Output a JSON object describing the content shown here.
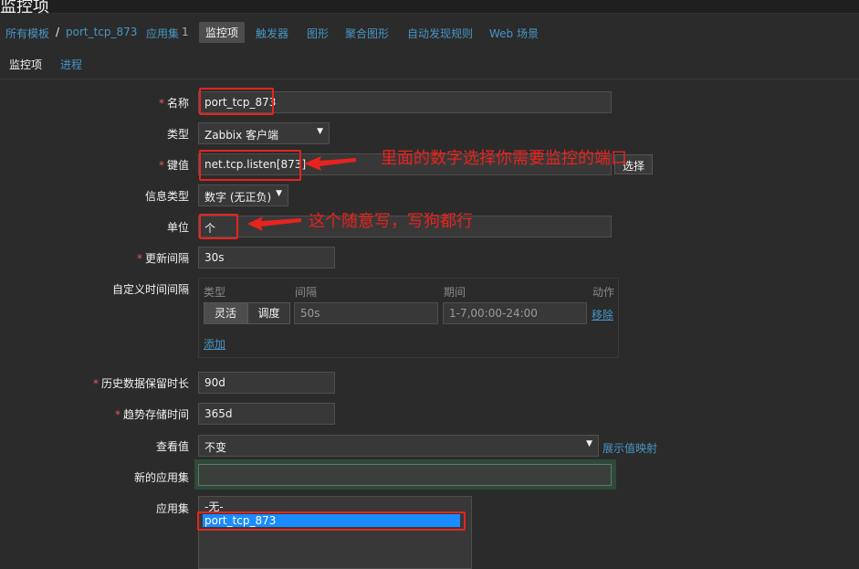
{
  "header": {
    "title": "监控项"
  },
  "breadcrumb": {
    "all_templates": "所有模板",
    "separator": "/",
    "template": "port_tcp_873",
    "applications": "应用集",
    "applications_count": "1",
    "items": "监控项",
    "triggers": "触发器",
    "graphs": "图形",
    "screens": "聚合图形",
    "discovery": "自动发现规则",
    "web": "Web 场景"
  },
  "tabs": {
    "item": "监控项",
    "process": "进程"
  },
  "form": {
    "name": {
      "label": "名称",
      "value": "port_tcp_873",
      "required": true
    },
    "type": {
      "label": "类型",
      "value": "Zabbix 客户端"
    },
    "key": {
      "label": "键值",
      "value": "net.tcp.listen[873]",
      "required": true,
      "select_button": "选择"
    },
    "value_type": {
      "label": "信息类型",
      "value": "数字 (无正负)"
    },
    "units": {
      "label": "单位",
      "value": "个"
    },
    "update_interval": {
      "label": "更新间隔",
      "value": "30s",
      "required": true
    },
    "custom_intervals": {
      "label": "自定义时间间隔",
      "col_type": "类型",
      "col_interval": "间隔",
      "col_period": "期间",
      "col_action": "动作",
      "flexible": "灵活",
      "scheduling": "调度",
      "interval_value": "50s",
      "period_value": "1-7,00:00-24:00",
      "remove": "移除",
      "add": "添加"
    },
    "history": {
      "label": "历史数据保留时长",
      "value": "90d",
      "required": true
    },
    "trends": {
      "label": "趋势存储时间",
      "value": "365d",
      "required": true
    },
    "valuemap": {
      "label": "查看值",
      "value": "不变",
      "show_link": "展示值映射"
    },
    "new_application": {
      "label": "新的应用集",
      "value": ""
    },
    "applications": {
      "label": "应用集",
      "options": [
        "-无-",
        "port_tcp_873"
      ],
      "selected": 1
    }
  },
  "annotations": {
    "key_note": "里面的数字选择你需要监控的端口",
    "units_note": "这个随意写，写狗都行"
  },
  "colors": {
    "accent": "#4796c4",
    "required": "#e45959",
    "annotation": "#e8231e",
    "selected": "#1a8cff"
  }
}
